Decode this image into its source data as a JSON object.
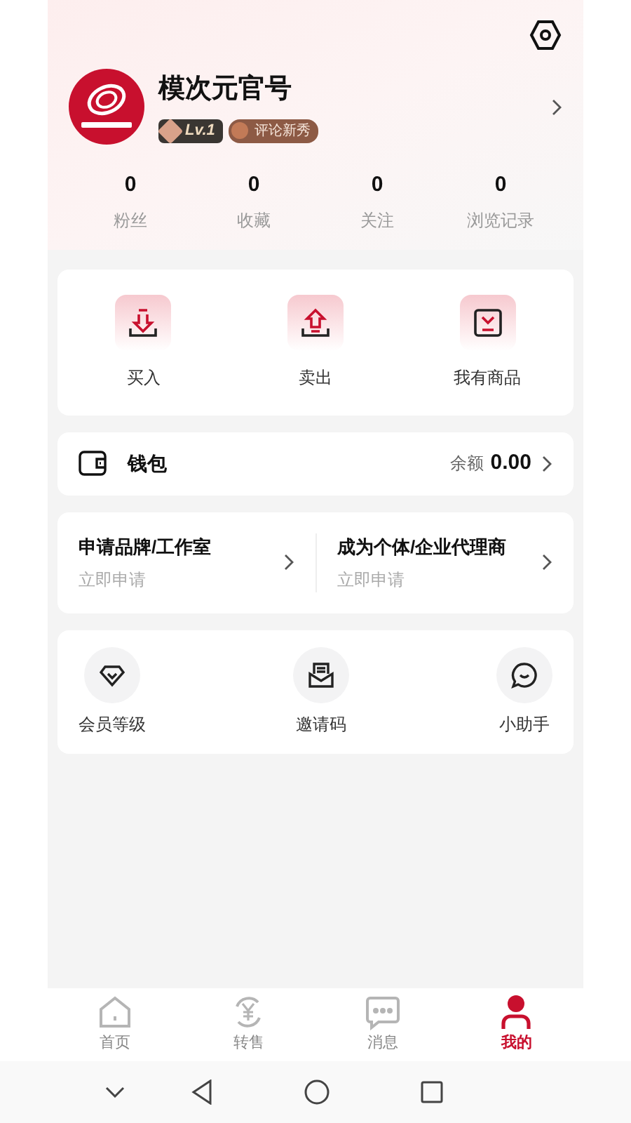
{
  "profile": {
    "name": "模次元官号",
    "level_badge": "Lv.1",
    "title_badge": "评论新秀"
  },
  "stats": [
    {
      "value": "0",
      "label": "粉丝"
    },
    {
      "value": "0",
      "label": "收藏"
    },
    {
      "value": "0",
      "label": "关注"
    },
    {
      "value": "0",
      "label": "浏览记录"
    }
  ],
  "trade_actions": [
    {
      "label": "买入"
    },
    {
      "label": "卖出"
    },
    {
      "label": "我有商品"
    }
  ],
  "wallet": {
    "title": "钱包",
    "balance_label": "余额",
    "balance": "0.00"
  },
  "applications": [
    {
      "title": "申请品牌/工作室",
      "subtitle": "立即申请"
    },
    {
      "title": "成为个体/企业代理商",
      "subtitle": "立即申请"
    }
  ],
  "services": [
    {
      "label": "会员等级"
    },
    {
      "label": "邀请码"
    },
    {
      "label": "小助手"
    }
  ],
  "tab_bar": [
    {
      "label": "首页",
      "selected": false
    },
    {
      "label": "转售",
      "selected": false
    },
    {
      "label": "消息",
      "selected": false
    },
    {
      "label": "我的",
      "selected": true
    }
  ]
}
